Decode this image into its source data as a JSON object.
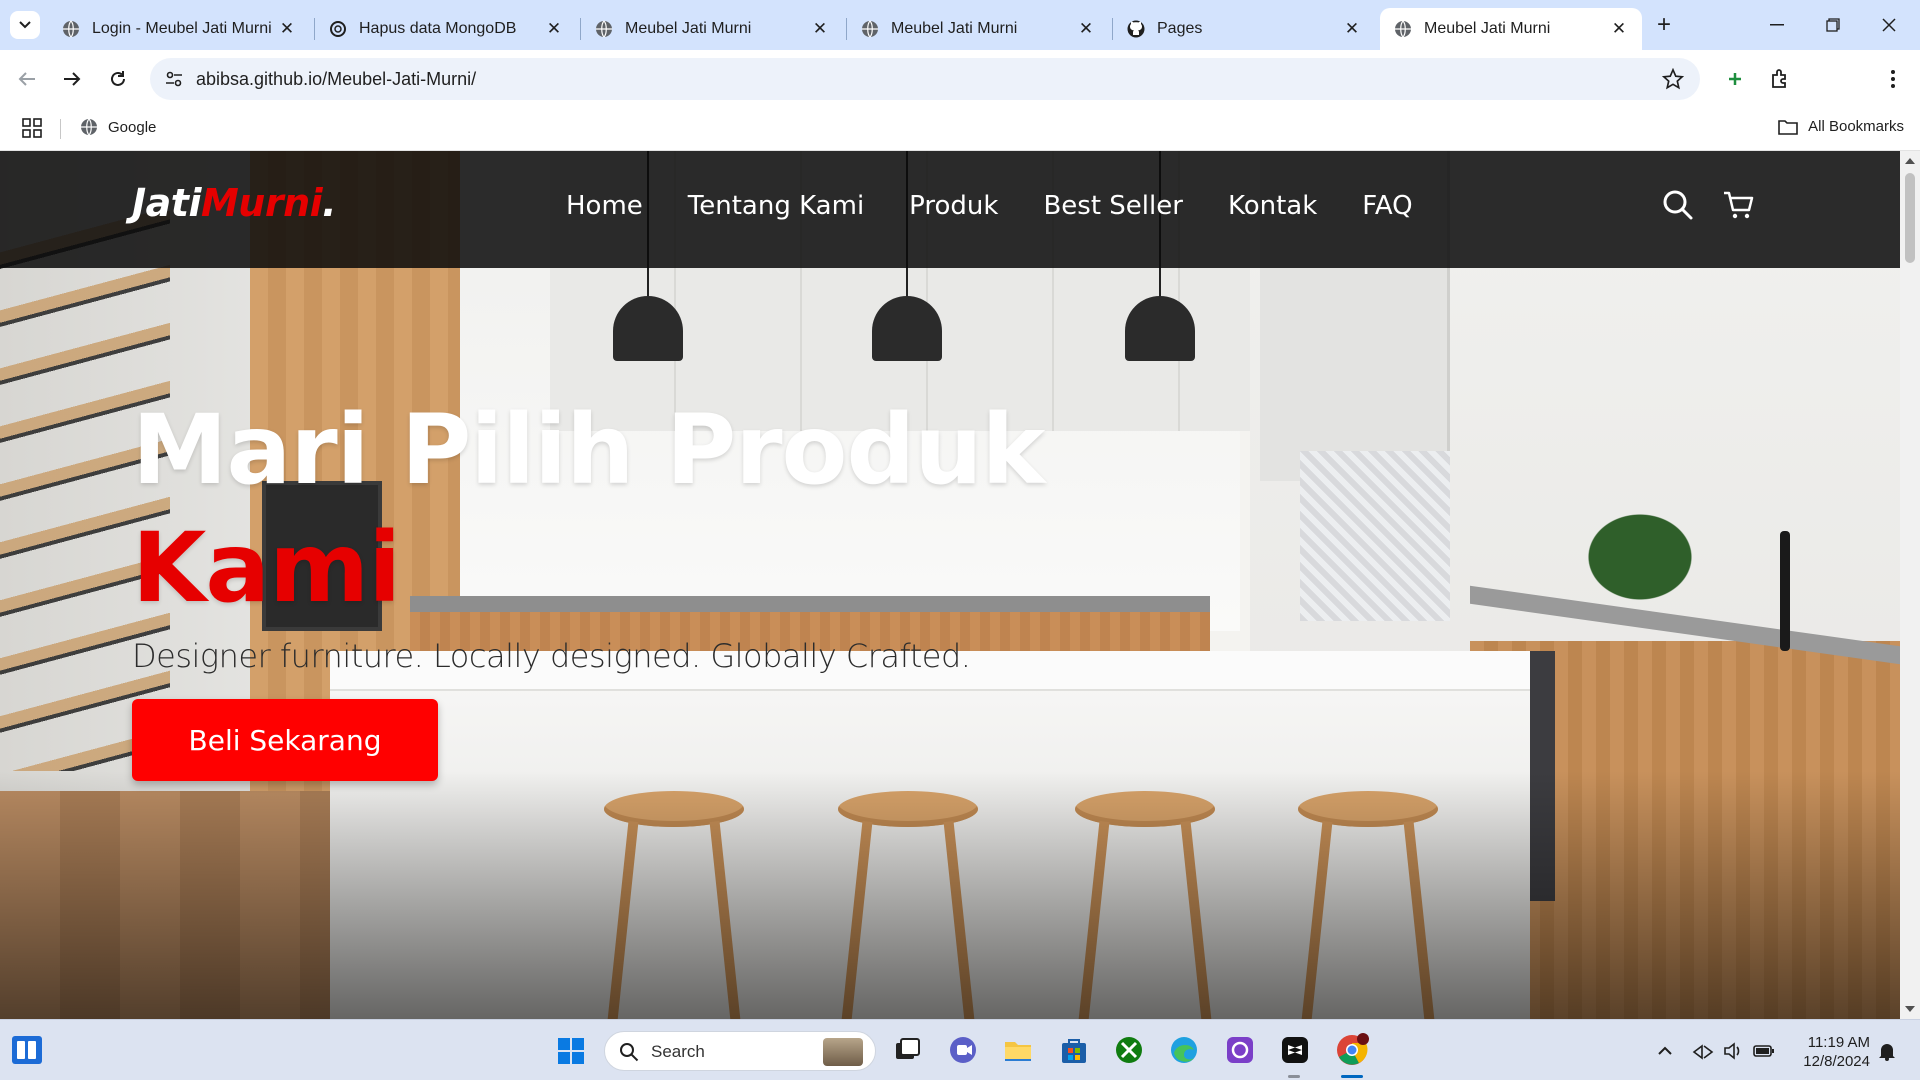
{
  "browser": {
    "tabs": [
      {
        "title": "Login - Meubel Jati Murni",
        "icon": "globe-icon"
      },
      {
        "title": "Hapus data MongoDB",
        "icon": "openai-icon"
      },
      {
        "title": "Meubel Jati Murni",
        "icon": "globe-icon"
      },
      {
        "title": "Meubel Jati Murni",
        "icon": "globe-icon"
      },
      {
        "title": "Pages",
        "icon": "github-icon"
      },
      {
        "title": "Meubel Jati Murni",
        "icon": "globe-icon",
        "active": true
      }
    ],
    "url": "abibsa.github.io/Meubel-Jati-Murni/",
    "bookmarks": {
      "google": "Google",
      "all": "All Bookmarks"
    }
  },
  "site": {
    "brand": {
      "main": "Jati",
      "accent": "Murni",
      "dot": "."
    },
    "nav": [
      "Home",
      "Tentang Kami",
      "Produk",
      "Best Seller",
      "Kontak",
      "FAQ"
    ],
    "hero": {
      "title_line1": "Mari Pilih Produk",
      "title_line2": "Kami",
      "subtitle": "Designer furniture. Locally designed. Globally Crafted.",
      "cta": "Beli Sekarang"
    },
    "colors": {
      "accent": "#e60000",
      "header_bg": "#111111",
      "button": "#ff0000"
    }
  },
  "taskbar": {
    "search_label": "Search",
    "time": "11:19 AM",
    "date": "12/8/2024"
  }
}
